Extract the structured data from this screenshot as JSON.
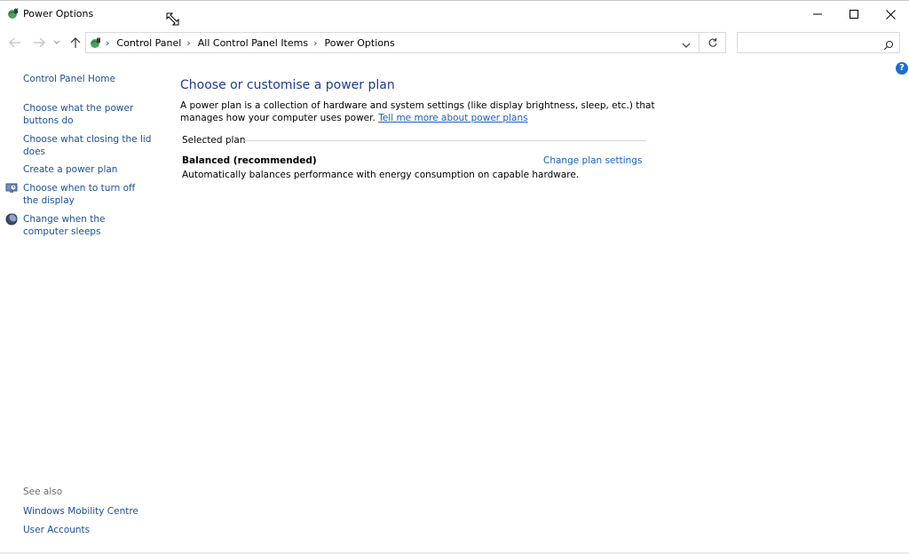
{
  "window": {
    "title": "Power Options",
    "icon": "power-options-icon",
    "controls": {
      "minimize": "minimize-icon",
      "maximize": "maximize-icon",
      "close": "close-icon"
    }
  },
  "navigation": {
    "back": "back-arrow-icon",
    "forward": "forward-arrow-icon",
    "recent": "chevron-down-icon",
    "up": "up-arrow-icon"
  },
  "address_bar": {
    "breadcrumbs": [
      "Control Panel",
      "All Control Panel Items",
      "Power Options"
    ],
    "refresh": "refresh-icon"
  },
  "search": {
    "value": "",
    "icon": "search-icon"
  },
  "sidebar": {
    "home": "Control Panel Home",
    "items": [
      {
        "label": "Choose what the power buttons do",
        "icon": null
      },
      {
        "label": "Choose what closing the lid does",
        "icon": null
      },
      {
        "label": "Create a power plan",
        "icon": null
      },
      {
        "label": "Choose when to turn off the display",
        "icon": "monitor-icon"
      },
      {
        "label": "Change when the computer sleeps",
        "icon": "moon-icon"
      }
    ],
    "see_also": {
      "heading": "See also",
      "links": [
        "Windows Mobility Centre",
        "User Accounts"
      ]
    }
  },
  "main": {
    "title": "Choose or customise a power plan",
    "description": "A power plan is a collection of hardware and system settings (like display brightness, sleep, etc.) that manages how your computer uses power.",
    "learn_more": "Tell me more about power plans",
    "selected_plan_heading": "Selected plan",
    "plan": {
      "name": "Balanced (recommended)",
      "change_link": "Change plan settings",
      "description": "Automatically balances performance with energy consumption on capable hardware."
    }
  },
  "colors": {
    "link": "#1a4f96",
    "heading": "#1e3c8c",
    "accent_link": "#1a5fc0",
    "help_badge": "#1a6fd1"
  }
}
